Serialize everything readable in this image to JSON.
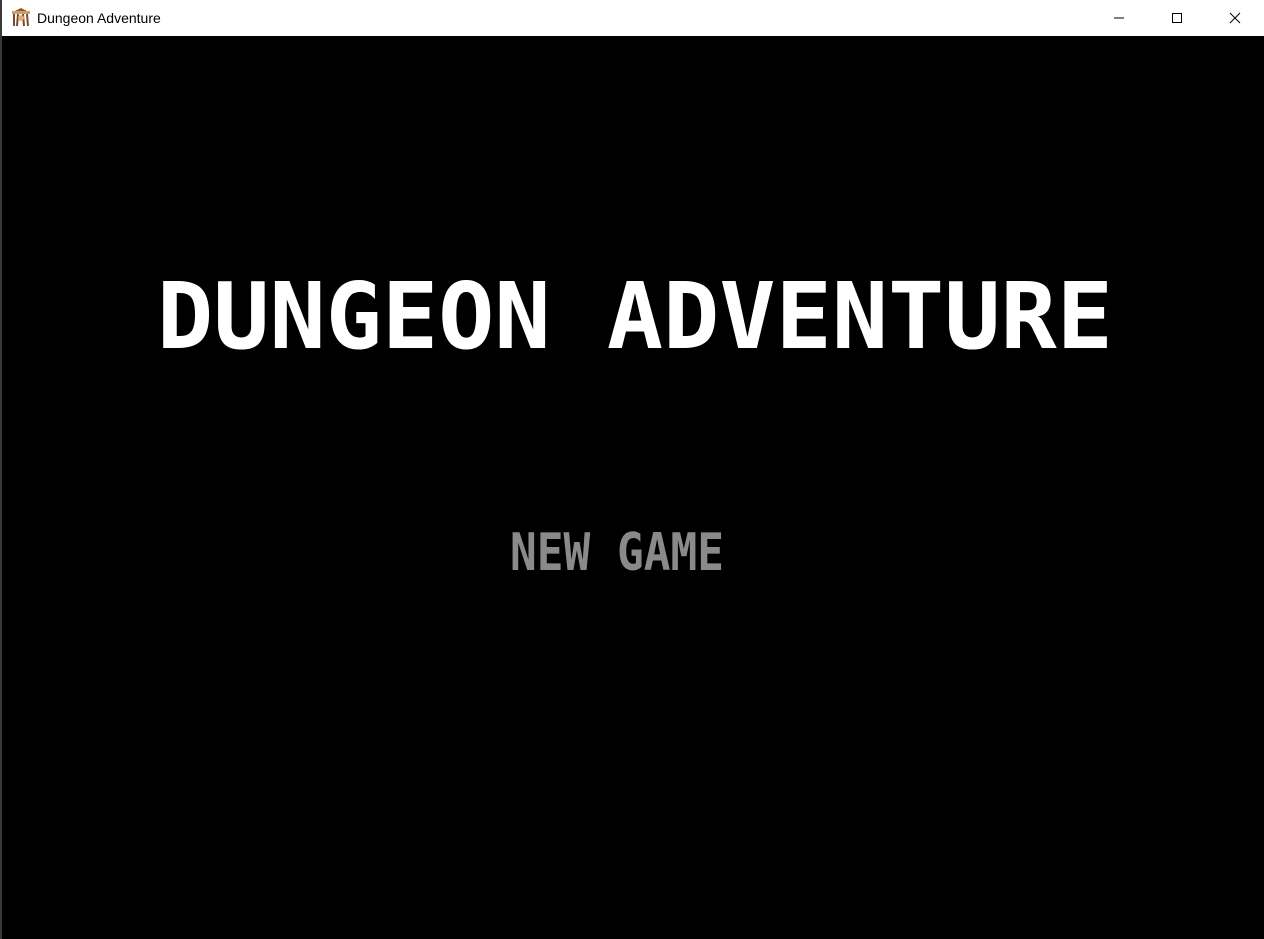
{
  "window": {
    "title": "Dungeon Adventure",
    "app_icon": "dungeon-app-icon",
    "controls": {
      "minimize_icon": "minimize-icon",
      "maximize_icon": "maximize-icon",
      "close_icon": "close-icon"
    }
  },
  "game": {
    "title": "DUNGEON ADVENTURE",
    "menu": {
      "new_game_label": "NEW GAME"
    }
  },
  "colors": {
    "background": "#000000",
    "title_text": "#ffffff",
    "menu_text": "#8a8a8a",
    "titlebar": "#ffffff"
  }
}
